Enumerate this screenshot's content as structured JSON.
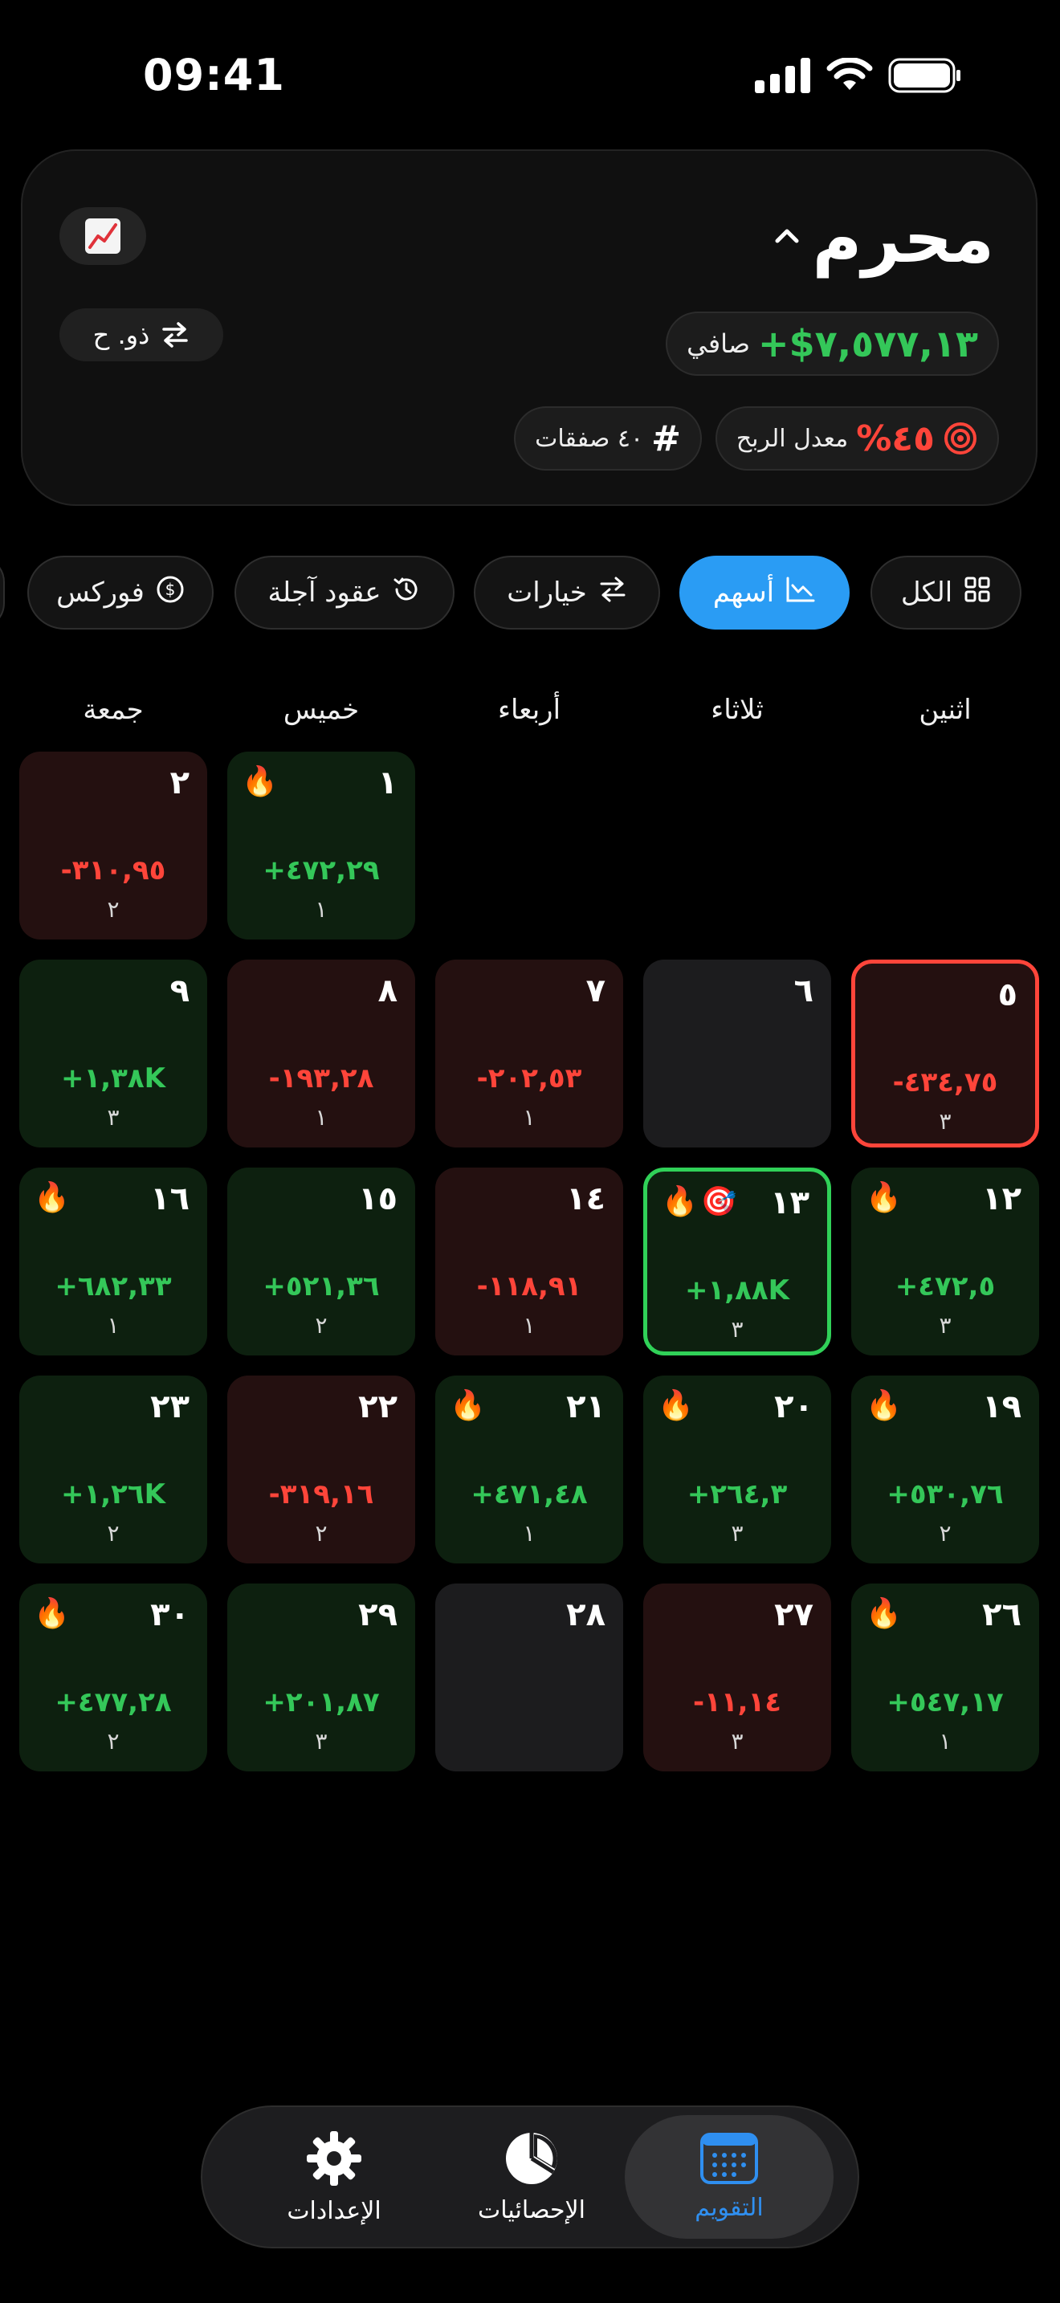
{
  "status": {
    "time": "09:41"
  },
  "header": {
    "month": "محرم",
    "prev_month_label": "ذو. ح",
    "net_value": "+$٧,٥٧٧,١٣",
    "net_label": "صافي",
    "winrate_value": "٤٥%",
    "winrate_label": "معدل الربح",
    "trades_label": "٤٠ صفقات",
    "icon": "chart-up-emoji"
  },
  "filters": [
    {
      "label": "الكل",
      "icon": "grid-icon",
      "active": false
    },
    {
      "label": "أسهم",
      "icon": "stock-chart-icon",
      "active": true
    },
    {
      "label": "خيارات",
      "icon": "arrows-swap-icon",
      "active": false
    },
    {
      "label": "عقود آجلة",
      "icon": "history-clock-icon",
      "active": false
    },
    {
      "label": "فوركس",
      "icon": "dollar-coin-icon",
      "active": false
    }
  ],
  "weekdays": [
    "اثنين",
    "ثلاثاء",
    "أربعاء",
    "خميس",
    "جمعة"
  ],
  "calendar": [
    {
      "day": "١",
      "pnl": "+٤٧٢,٢٩",
      "count": "١",
      "status": "pos",
      "fire": true
    },
    {
      "day": "٢",
      "pnl": "-٣١٠,٩٥",
      "count": "٢",
      "status": "neg"
    },
    {
      "day": "٥",
      "pnl": "-٤٣٤,٧٥",
      "count": "٣",
      "status": "neg",
      "selected": "red"
    },
    {
      "day": "٦",
      "status": "empty"
    },
    {
      "day": "٧",
      "pnl": "-٢٠٢,٥٣",
      "count": "١",
      "status": "neg"
    },
    {
      "day": "٨",
      "pnl": "-١٩٣,٢٨",
      "count": "١",
      "status": "neg"
    },
    {
      "day": "٩",
      "pnl": "+١,٣٨K",
      "count": "٣",
      "status": "pos"
    },
    {
      "day": "١٢",
      "pnl": "+٤٧٢,٥",
      "count": "٣",
      "status": "pos",
      "fire": true
    },
    {
      "day": "١٣",
      "pnl": "+١,٨٨K",
      "count": "٣",
      "status": "pos",
      "fire": true,
      "target": true,
      "selected": "green"
    },
    {
      "day": "١٤",
      "pnl": "-١١٨,٩١",
      "count": "١",
      "status": "neg"
    },
    {
      "day": "١٥",
      "pnl": "+٥٢١,٣٦",
      "count": "٢",
      "status": "pos"
    },
    {
      "day": "١٦",
      "pnl": "+٦٨٢,٣٣",
      "count": "١",
      "status": "pos",
      "fire": true
    },
    {
      "day": "١٩",
      "pnl": "+٥٣٠,٧٦",
      "count": "٢",
      "status": "pos",
      "fire": true
    },
    {
      "day": "٢٠",
      "pnl": "+٢٦٤,٣",
      "count": "٣",
      "status": "pos",
      "fire": true
    },
    {
      "day": "٢١",
      "pnl": "+٤٧١,٤٨",
      "count": "١",
      "status": "pos",
      "fire": true
    },
    {
      "day": "٢٢",
      "pnl": "-٣١٩,١٦",
      "count": "٢",
      "status": "neg"
    },
    {
      "day": "٢٣",
      "pnl": "+١,٢٦K",
      "count": "٢",
      "status": "pos"
    },
    {
      "day": "٢٦",
      "pnl": "+٥٤٧,١٧",
      "count": "١",
      "status": "pos",
      "fire": true
    },
    {
      "day": "٢٧",
      "pnl": "-١١,١٤",
      "count": "٣",
      "status": "neg"
    },
    {
      "day": "٢٨",
      "status": "empty"
    },
    {
      "day": "٢٩",
      "pnl": "+٢٠١,٨٧",
      "count": "٣",
      "status": "pos"
    },
    {
      "day": "٣٠",
      "pnl": "+٤٧٧,٢٨",
      "count": "٢",
      "status": "pos",
      "fire": true
    }
  ],
  "tabs": [
    {
      "label": "التقويم",
      "icon": "calendar-icon",
      "active": true
    },
    {
      "label": "الإحصائيات",
      "icon": "pie-chart-icon",
      "active": false
    },
    {
      "label": "الإعدادات",
      "icon": "gear-icon",
      "active": false
    }
  ],
  "colors": {
    "positive": "#34c759",
    "negative": "#ff453a",
    "accent": "#2a9cf4"
  }
}
